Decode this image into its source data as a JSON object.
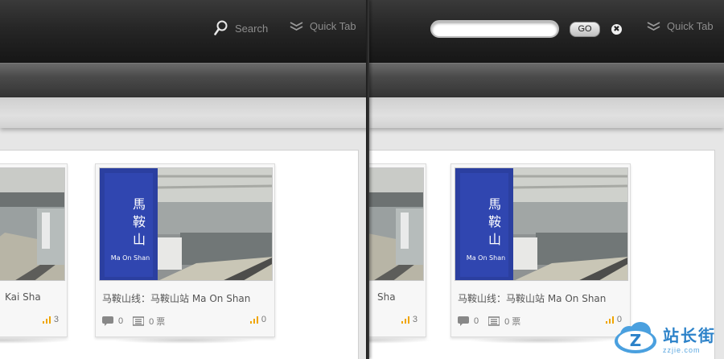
{
  "left_pane": {
    "nav": {
      "search_label": "Search",
      "quick_tab_label": "Quick Tab"
    },
    "cards": [
      {
        "title": "Kai Sha",
        "hot_count": "3"
      },
      {
        "title": "马鞍山线：马鞍山站 Ma On Shan",
        "comments": "0",
        "votes": "0 票",
        "hot_count": "0",
        "sign_text": "馬\n鞍\n山",
        "sign_en": "Ma On Shan"
      }
    ]
  },
  "right_pane": {
    "nav": {
      "search_value": "",
      "go_label": "GO",
      "close_icon": "✖",
      "quick_tab_label": "Quick Tab"
    },
    "cards": [
      {
        "title": "Sha",
        "hot_count": "3"
      },
      {
        "title": "马鞍山线：马鞍山站 Ma On Shan",
        "comments": "0",
        "votes": "0 票",
        "hot_count": "0",
        "sign_text": "馬\n鞍\n山",
        "sign_en": "Ma On Shan"
      }
    ]
  },
  "watermark": {
    "cn": "站长街",
    "en": "zzjie.com"
  },
  "colors": {
    "hot_bar": "#f0a500",
    "sign_blue": "#2b3fa0"
  }
}
